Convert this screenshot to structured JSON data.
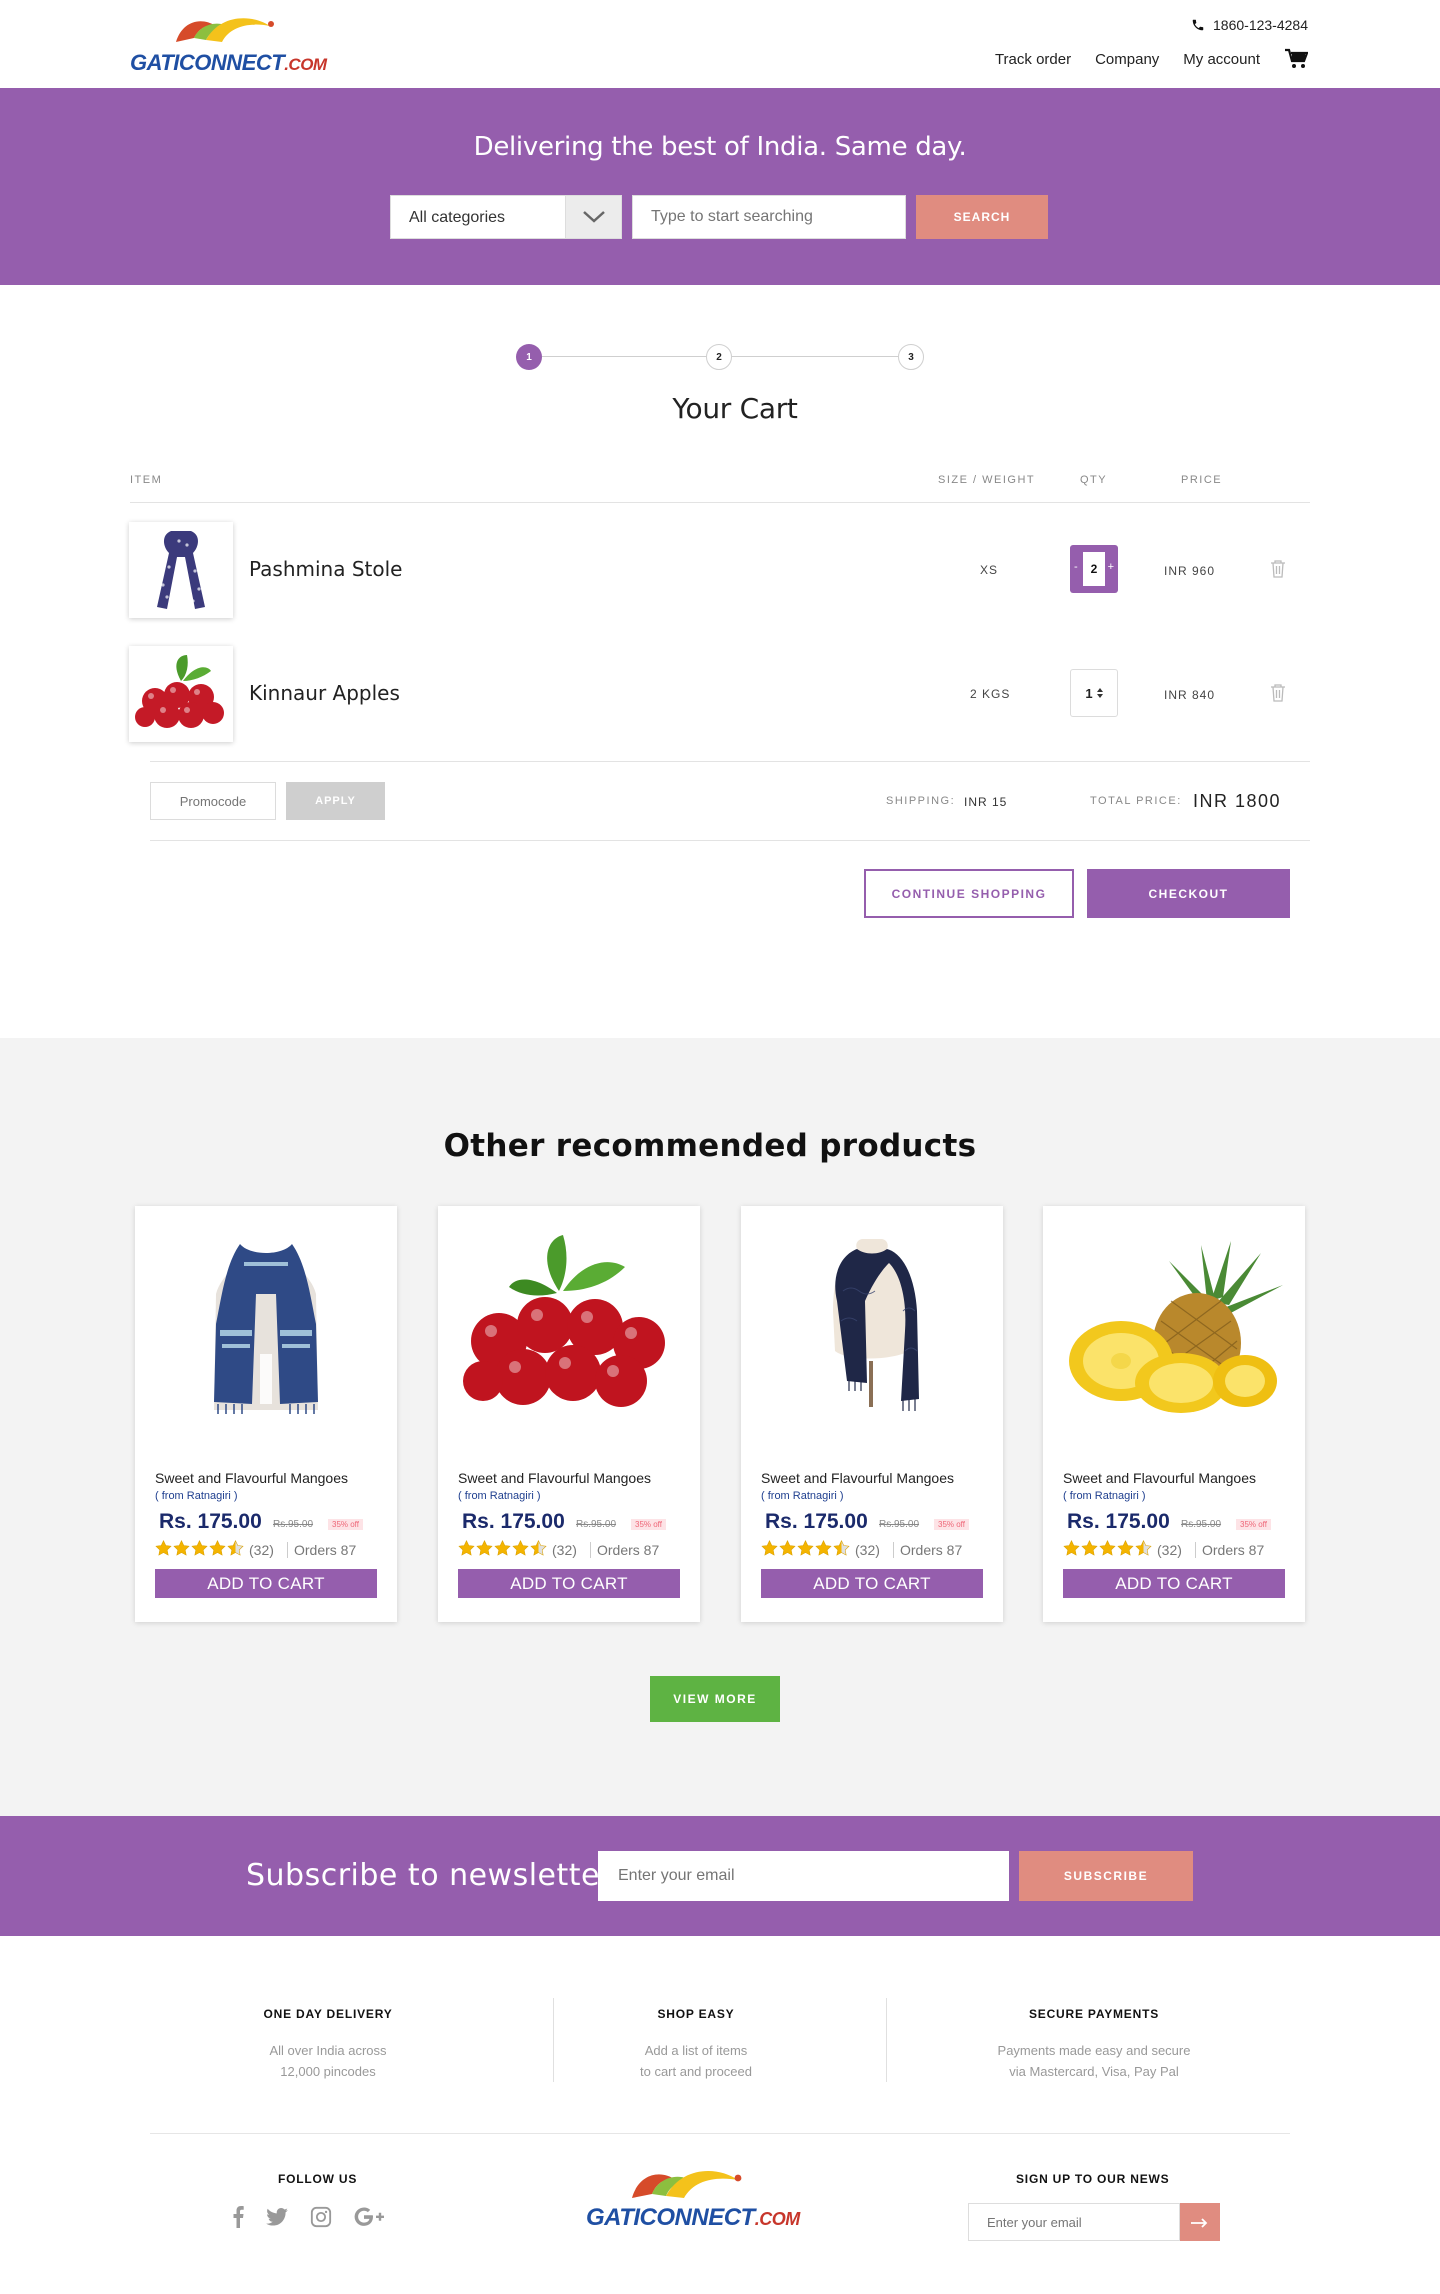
{
  "header": {
    "logo": {
      "gati": "GATI",
      "connect": "CONNECT",
      "dotcom": ".COM"
    },
    "phone": "1860-123-4284",
    "nav": [
      "Track order",
      "Company",
      "My account"
    ]
  },
  "hero": {
    "title": "Delivering the best of India. Same day.",
    "category_selected": "All categories",
    "search_placeholder": "Type to start searching",
    "search_label": "SEARCH"
  },
  "stepper": {
    "steps": [
      "1",
      "2",
      "3"
    ],
    "active_step": 1
  },
  "cart": {
    "title": "Your Cart",
    "headers": {
      "item": "ITEM",
      "size": "SIZE / WEIGHT",
      "qty": "QTY",
      "price": "PRICE"
    },
    "items": [
      {
        "name": "Pashmina Stole",
        "size": "XS",
        "qty": "2",
        "price": "INR 960"
      },
      {
        "name": "Kinnaur Apples",
        "size": "2 KGS",
        "qty": "1",
        "price": "INR 840"
      }
    ],
    "promo_placeholder": "Promocode",
    "apply_label": "APPLY",
    "shipping_label": "SHIPPING:",
    "shipping_value": "INR 15",
    "total_label": "TOTAL PRICE:",
    "total_value": "INR 1800",
    "continue_label": "CONTINUE SHOPPING",
    "checkout_label": "CHECKOUT"
  },
  "recommended": {
    "title": "Other recommended products",
    "products": [
      {
        "name": "Sweet and Flavourful Mangoes",
        "origin": "( from Ratnagiri )",
        "price": "Rs. 175.00",
        "mrp": "Rs.95.00",
        "off": "35% off",
        "rating": 4.5,
        "reviews": "(32)",
        "orders": "Orders 87",
        "cta": "ADD TO CART",
        "image": "stole-icon"
      },
      {
        "name": "Sweet and Flavourful Mangoes",
        "origin": "( from Ratnagiri )",
        "price": "Rs. 175.00",
        "mrp": "Rs.95.00",
        "off": "35% off",
        "rating": 4.5,
        "reviews": "(32)",
        "orders": "Orders 87",
        "cta": "ADD TO CART",
        "image": "cherries-icon"
      },
      {
        "name": "Sweet and Flavourful Mangoes",
        "origin": "( from Ratnagiri )",
        "price": "Rs. 175.00",
        "mrp": "Rs.95.00",
        "off": "35% off",
        "rating": 4.5,
        "reviews": "(32)",
        "orders": "Orders 87",
        "cta": "ADD TO CART",
        "image": "shawl-icon"
      },
      {
        "name": "Sweet and Flavourful Mangoes",
        "origin": "( from Ratnagiri )",
        "price": "Rs. 175.00",
        "mrp": "Rs.95.00",
        "off": "35% off",
        "rating": 4.5,
        "reviews": "(32)",
        "orders": "Orders 87",
        "cta": "ADD TO CART",
        "image": "pineapple-icon"
      }
    ],
    "view_more": "VIEW MORE"
  },
  "newsletter": {
    "title": "Subscribe to newsletter",
    "placeholder": "Enter your email",
    "button": "SUBSCRIBE"
  },
  "features": [
    {
      "title": "ONE DAY DELIVERY",
      "line1": "All over India across",
      "line2": "12,000 pincodes"
    },
    {
      "title": "SHOP EASY",
      "line1": "Add a list of items",
      "line2": "to cart and proceed"
    },
    {
      "title": "SECURE PAYMENTS",
      "line1": "Payments made easy and secure",
      "line2": "via Mastercard, Visa, Pay Pal"
    }
  ],
  "footer": {
    "follow": "FOLLOW US",
    "socials": [
      "facebook-icon",
      "twitter-icon",
      "instagram-icon",
      "google-plus-icon"
    ],
    "signup": "SIGN UP TO OUR NEWS",
    "placeholder": "Enter your email"
  },
  "colors": {
    "brand": "#955ead",
    "accent": "#e08c80",
    "green": "#5eb343",
    "price": "#1b2a6b"
  }
}
